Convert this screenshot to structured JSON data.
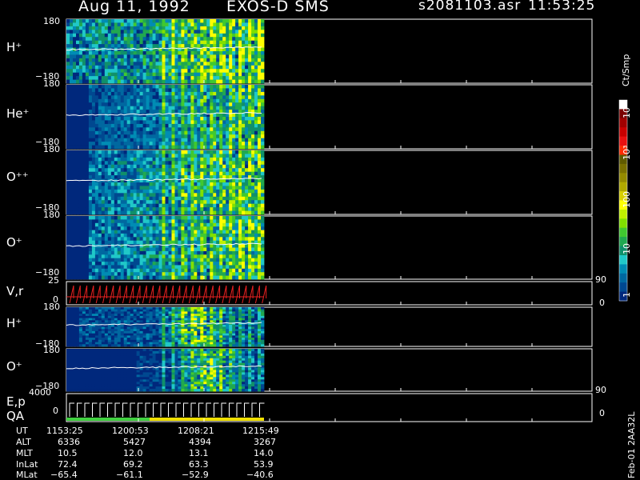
{
  "header": {
    "date": "Aug 11, 1992",
    "instrument": "EXOS-D SMS",
    "file": "s2081103.asr",
    "time": "11:53:25"
  },
  "colorbar": {
    "unit_label": "Ct/Smp",
    "ticks": [
      "10⁴",
      "10³",
      "100",
      "10",
      "1"
    ],
    "colors": [
      "#ffffff",
      "#7a0000",
      "#a00000",
      "#c80000",
      "#e81010",
      "#ff2a00",
      "#5f5a00",
      "#7a7000",
      "#948a00",
      "#b0a800",
      "#d8d000",
      "#ffff00",
      "#c0f000",
      "#80e000",
      "#40c830",
      "#20a850",
      "#10906a",
      "#20c8c8",
      "#008cb4",
      "#0068a0",
      "#004890",
      "#00287c"
    ]
  },
  "chart_data": [
    {
      "type": "heatmap",
      "species": "H+",
      "label": "H⁺",
      "yticks": [
        "180",
        "−180"
      ],
      "ylim": [
        -180,
        180
      ]
    },
    {
      "type": "heatmap",
      "species": "He+",
      "label": "He⁺",
      "yticks": [
        "180",
        "−180"
      ],
      "ylim": [
        -180,
        180
      ]
    },
    {
      "type": "heatmap",
      "species": "O++",
      "label": "O⁺⁺",
      "yticks": [
        "180",
        "−180"
      ],
      "ylim": [
        -180,
        180
      ]
    },
    {
      "type": "heatmap",
      "species": "O+",
      "label": "O⁺",
      "yticks": [
        "180",
        "−180"
      ],
      "ylim": [
        -180,
        180
      ]
    },
    {
      "type": "line",
      "label": "V,r",
      "yticks": [
        "25",
        "0"
      ],
      "ylim": [
        0,
        25
      ],
      "right_ticks": [
        "90",
        "0"
      ]
    },
    {
      "type": "heatmap",
      "species": "H+",
      "label": "H⁺",
      "yticks": [
        "180",
        "−180"
      ],
      "ylim": [
        -180,
        180
      ]
    },
    {
      "type": "heatmap",
      "species": "O+",
      "label": "O⁺",
      "yticks": [
        "180",
        "−180"
      ],
      "ylim": [
        -180,
        180
      ]
    },
    {
      "type": "line",
      "label": "E,p",
      "label2": "QA",
      "yticks": [
        "4000",
        "0"
      ],
      "ylim": [
        0,
        4000
      ],
      "right_ticks": [
        "90",
        "0"
      ]
    }
  ],
  "ephemeris": {
    "rows": [
      {
        "name": "UT",
        "values": [
          "1153:25",
          "1200:53",
          "1208:21",
          "1215:49"
        ]
      },
      {
        "name": "ALT",
        "values": [
          "6336",
          "5427",
          "4394",
          "3267"
        ]
      },
      {
        "name": "MLT",
        "values": [
          "10.5",
          "12.0",
          "13.1",
          "14.0"
        ]
      },
      {
        "name": "InLat",
        "values": [
          "72.4",
          "69.2",
          "63.3",
          "53.9"
        ]
      },
      {
        "name": "MLat",
        "values": [
          "−65.4",
          "−61.1",
          "−52.9",
          "−40.6"
        ]
      }
    ]
  },
  "footer": {
    "stamp": "Feb-01 2AA32L"
  }
}
